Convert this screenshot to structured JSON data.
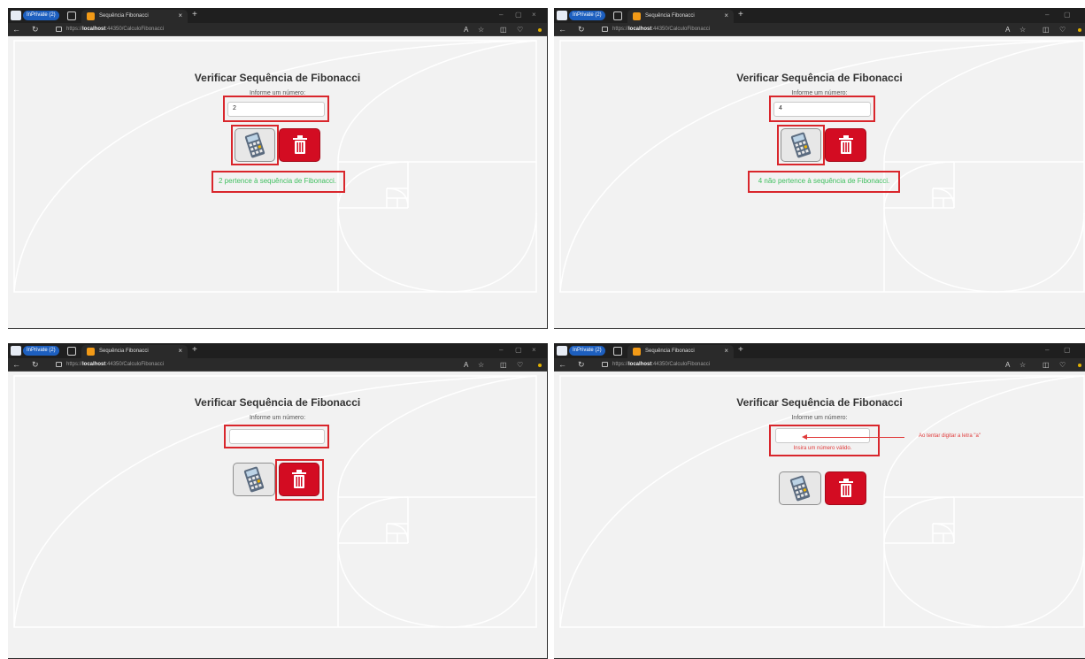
{
  "browser": {
    "profile_badge": "InPrivate (2)",
    "tab_title": "Sequência Fibonacci",
    "tab_close": "×",
    "new_tab": "+",
    "url_prefix": "https://",
    "url_host": "localhost",
    "url_path": ":44350/CalculoFibonacci",
    "window_controls": [
      "–",
      "▢",
      "×"
    ]
  },
  "page": {
    "title": "Verificar Sequência de Fibonacci",
    "input_label": "Informe um número:"
  },
  "panels": [
    {
      "input_value": "2",
      "result": "2 pertence à sequência de Fibonacci.",
      "result_color": "#3fbf5f",
      "highlight": [
        "input",
        "calculate-button",
        "result"
      ]
    },
    {
      "input_value": "4",
      "result": "4 não pertence à sequência de Fibonacci.",
      "result_color": "#3fbf5f",
      "highlight": [
        "input",
        "calculate-button",
        "result"
      ]
    },
    {
      "input_value": "",
      "result": "",
      "highlight": [
        "input",
        "clear-button"
      ]
    },
    {
      "input_value": "",
      "validation": "Insira um número válido.",
      "annotation": "Ao tentar digitar a letra \"a\"",
      "highlight": [
        "input"
      ]
    }
  ],
  "colors": {
    "highlight": "#d9262c",
    "trash_button": "#d30c22",
    "success_text": "#3fbf5f",
    "error_text": "#e03a3a",
    "browser_chrome": "#1f1f1f",
    "page_background": "#f2f2f2"
  },
  "icons": [
    "calculator-icon",
    "trash-icon",
    "back-icon",
    "refresh-icon",
    "lock-icon",
    "read-aloud-icon",
    "favorite-icon",
    "split-screen-icon",
    "copilot-icon",
    "favicon"
  ]
}
